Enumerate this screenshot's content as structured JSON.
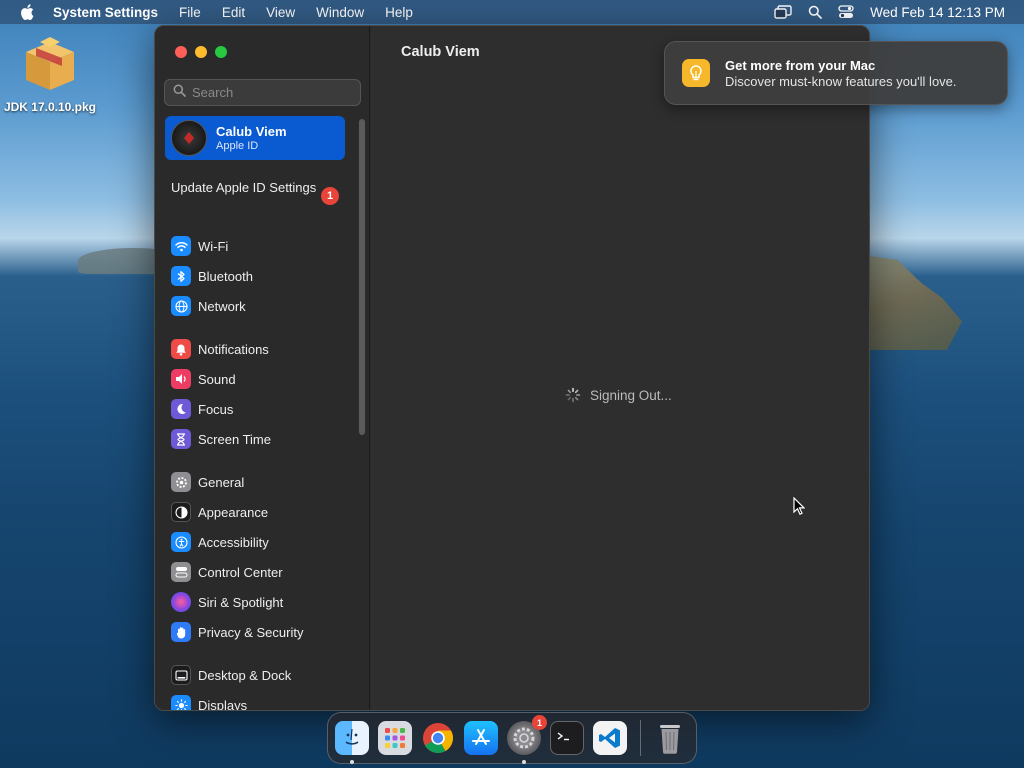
{
  "menubar": {
    "app_name": "System Settings",
    "menus": [
      "File",
      "Edit",
      "View",
      "Window",
      "Help"
    ],
    "clock": "Wed Feb 14  12:13 PM"
  },
  "desktop": {
    "file_label": "JDK 17.0.10.pkg"
  },
  "sidebar": {
    "search_placeholder": "Search",
    "account": {
      "name": "Calub Viem",
      "subtitle": "Apple ID"
    },
    "update": {
      "label": "Update Apple ID Settings",
      "badge": "1"
    },
    "groups": [
      [
        {
          "label": "Wi-Fi",
          "icon": "wifi-icon",
          "color": "#1a8cff"
        },
        {
          "label": "Bluetooth",
          "icon": "bluetooth-icon",
          "color": "#1a8cff"
        },
        {
          "label": "Network",
          "icon": "globe-icon",
          "color": "#1a8cff"
        }
      ],
      [
        {
          "label": "Notifications",
          "icon": "bell-icon",
          "color": "#ef4b47"
        },
        {
          "label": "Sound",
          "icon": "speaker-icon",
          "color": "#ef3c63"
        },
        {
          "label": "Focus",
          "icon": "moon-icon",
          "color": "#6e5ad6"
        },
        {
          "label": "Screen Time",
          "icon": "hourglass-icon",
          "color": "#6e5ad6"
        }
      ],
      [
        {
          "label": "General",
          "icon": "gear-icon",
          "color": "#8e8e93"
        },
        {
          "label": "Appearance",
          "icon": "appearance-icon",
          "color": "#1c1c1e"
        },
        {
          "label": "Accessibility",
          "icon": "accessibility-icon",
          "color": "#1a8cff"
        },
        {
          "label": "Control Center",
          "icon": "toggles-icon",
          "color": "#8e8e93"
        },
        {
          "label": "Siri & Spotlight",
          "icon": "siri-icon",
          "color": "#b03ad8"
        },
        {
          "label": "Privacy & Security",
          "icon": "hand-icon",
          "color": "#2f7bf5"
        }
      ],
      [
        {
          "label": "Desktop & Dock",
          "icon": "dock-icon",
          "color": "#1c1c1e"
        },
        {
          "label": "Displays",
          "icon": "sun-icon",
          "color": "#1a8cff"
        }
      ]
    ]
  },
  "content": {
    "title": "Calub Viem",
    "status": "Signing Out..."
  },
  "notification": {
    "title": "Get more from your Mac",
    "body": "Discover must-know features you'll love."
  },
  "dock": {
    "apps": [
      "finder-icon",
      "launchpad-icon",
      "chrome-icon",
      "app-store-icon",
      "system-settings-icon",
      "terminal-icon",
      "vscode-icon"
    ],
    "settings_badge": "1"
  }
}
